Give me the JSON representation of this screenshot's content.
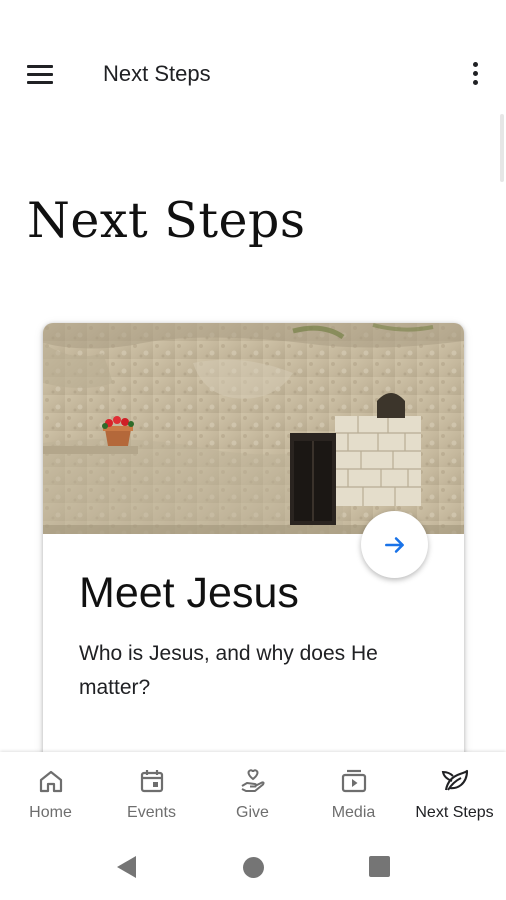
{
  "app_bar": {
    "title": "Next Steps"
  },
  "page": {
    "heading": "Next Steps"
  },
  "card": {
    "title": "Meet Jesus",
    "description": "Who is Jesus, and why does He matter?",
    "image_icon": "garden-tomb-photo",
    "action_icon": "arrow-right-icon"
  },
  "bottom_nav": {
    "items": [
      {
        "label": "Home",
        "icon": "home-icon"
      },
      {
        "label": "Events",
        "icon": "calendar-icon"
      },
      {
        "label": "Give",
        "icon": "give-hand-heart-icon"
      },
      {
        "label": "Media",
        "icon": "media-play-icon"
      },
      {
        "label": "Next Steps",
        "icon": "sprout-leaf-icon",
        "active": true
      }
    ]
  },
  "colors": {
    "accent": "#1a73e8",
    "text": "#202124",
    "nav_inactive": "#6e6e6e"
  }
}
